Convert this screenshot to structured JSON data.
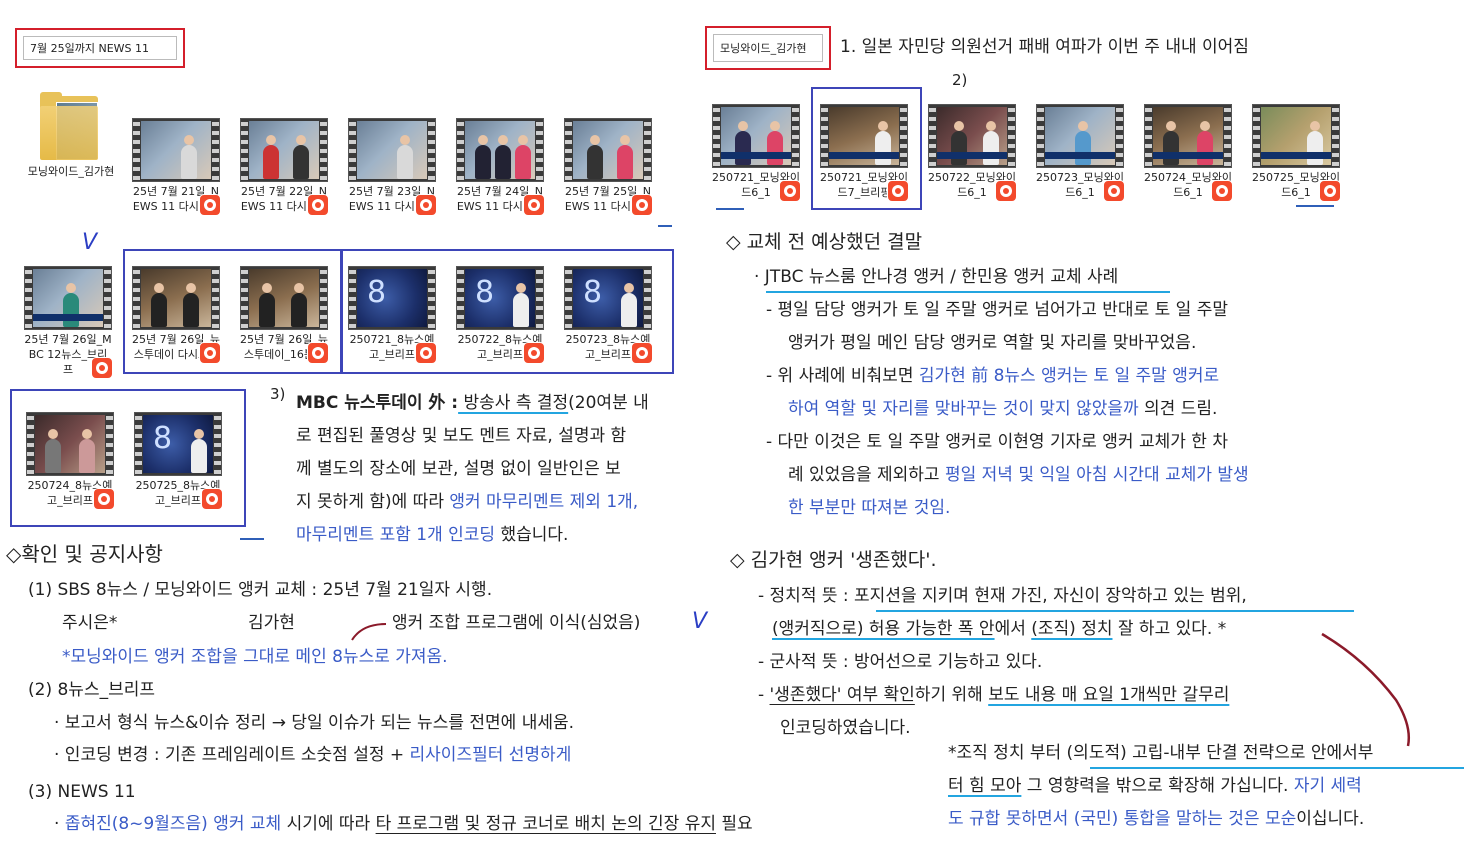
{
  "left_label": "7월 25일까지 NEWS 11",
  "right_label": "모닝와이드_김가현",
  "folder_caption": "모닝와이드_김가현",
  "row1": [
    {
      "caption": "25년 7월 21일_NEWS 11 다시보기"
    },
    {
      "caption": "25년 7월 22일_NEWS 11 다시보기"
    },
    {
      "caption": "25년 7월 23일_NEWS 11 다시보기"
    },
    {
      "caption": "25년 7월 24일_NEWS 11 다시보기"
    },
    {
      "caption": "25년 7월 25일_NEWS 11 다시보기"
    }
  ],
  "row2": [
    {
      "caption": "25년 7월 26일_MBC 12뉴스_브리프"
    },
    {
      "caption": "25년 7월 26일_뉴스투데이 다시보기"
    },
    {
      "caption": "25년 7월 26일_뉴스투데이_16분컷"
    },
    {
      "caption": "250721_8뉴스예고_브리프"
    },
    {
      "caption": "250722_8뉴스예고_브리프"
    },
    {
      "caption": "250723_8뉴스예고_브리프"
    }
  ],
  "row3": [
    {
      "caption": "250724_8뉴스예고_브리프"
    },
    {
      "caption": "250725_8뉴스예고_브리프"
    }
  ],
  "right_row": [
    {
      "caption": "250721_모닝와이드6_1"
    },
    {
      "caption": "250721_모닝와이드7_브리핑"
    },
    {
      "caption": "250722_모닝와이드6_1"
    },
    {
      "caption": "250723_모닝와이드6_1"
    },
    {
      "caption": "250724_모닝와이드6_1"
    },
    {
      "caption": "250725_모닝와이드6_1"
    }
  ],
  "check_mark": "V",
  "right_heading": "1. 일본 자민당 의원선거 패배 여파가 이번 주 내내 이어짐",
  "right_num2": "2)",
  "note3": {
    "num": "3)",
    "bold": "MBC 뉴스투데이 外 :",
    "l1b": " 방송사 측 결정",
    "l1c": "(20여분 내",
    "l2": "로 편집된 풀영상 및 보도 멘트 자료, 설명과 함",
    "l3": "께 별도의 장소에 보관, 설명 없이 일반인은 보",
    "l4a": "지 못하게 함)에 따라 ",
    "l4b": "앵커 마무리멘트 제외 1개,",
    "l5a": "마무리멘트 포함 1개 인코딩",
    "l5b": " 했습니다."
  },
  "confirm": {
    "title": "◇확인 및 공지사항",
    "i1": "(1) SBS 8뉴스    /    모닝와이드 앵커 교체 : 25년 7월 21일자 시행.",
    "i1b_a": "주시은*",
    "i1b_b": "김가현",
    "i1b_c": "앵커 조합 프로그램에 이식(심었음)",
    "i1c": "*모닝와이드 앵커 조합을 그대로 메인 8뉴스로 가져옴.",
    "i2": "(2) 8뉴스_브리프",
    "i2a": "· 보고서 형식 뉴스&이슈 정리 → 당일 이슈가 되는 뉴스를 전면에 내세움.",
    "i2b_a": "· 인코딩 변경 : 기존 프레임레이트 소숫점 설정 + ",
    "i2b_b": "리사이즈필터 선명하게",
    "i3": "(3) NEWS 11",
    "i3a_a": "· ",
    "i3a_b": "좁혀진(8~9월즈음) 앵커 교체",
    "i3a_c": " 시기에 따라 ",
    "i3a_d": "타 프로그램 및 정규 코너로 배치 논의 긴장 유지",
    "i3a_e": " 필요"
  },
  "expected": {
    "title": "◇ 교체 전 예상했던 결말",
    "sub": "· JTBC 뉴스룸 안나경 앵커    /    한민용 앵커 교체 사례",
    "a1": "-  평일 담당 앵커가 토 일 주말 앵커로 넘어가고 반대로 토 일 주말",
    "a2": "앵커가 평일 메인 담당 앵커로 역할 및 자리를 맞바꾸었음.",
    "b1a": "-  위 사례에 비춰보면 ",
    "b1b": "김가현 前 8뉴스 앵커는 토 일 주말 앵커로",
    "b2a": "하여 역할 및 자리를 맞바꾸는 것이 맞지 않았을까",
    "b2b": " 의견 드림.",
    "c1": "-  다만 이것은 토 일 주말 앵커로 이현영 기자로 앵커 교체가 한 차",
    "c2a": "례 있었음을 제외하고 ",
    "c2b": "평일 저녁 및 익일 아침 시간대 교체가 발생",
    "c3": "한 부분만 따져본 것임."
  },
  "survived": {
    "title": "◇ 김가현 앵커 '생존했다'.",
    "a1": "-  정치적 뜻 : 포지션을 지키며 현재 가진, 자신이 장악하고 있는 범위,",
    "a2a": "(앵커직으로) 허용 가능한 폭 안",
    "a2b": "에서 ",
    "a2c": "(조직) 정치",
    "a2d": " 잘 하고 있다.  *",
    "b1": "-  군사적 뜻 : 방어선으로 기능하고 있다.",
    "c1a": "-  ",
    "c1b": "'생존했다' 여부 확인",
    "c1c": "하기 위해 ",
    "c1d": "보도 내용 매 요일 1개씩만 갈무리",
    "c2": "인코딩하였습니다.",
    "n1": "*조직 정치 부터 (의도적) 고립-내부 단결 전략으로 안에서부",
    "n2a": "터 힘 모아",
    "n2b": " 그 영향력을 밖으로 확장해 가십니다. ",
    "n2c": "자기 세력",
    "n3a": "도 규합 못하면서 (국민) 통합을 말하는 것은 모순",
    "n3b": "이십니다."
  }
}
